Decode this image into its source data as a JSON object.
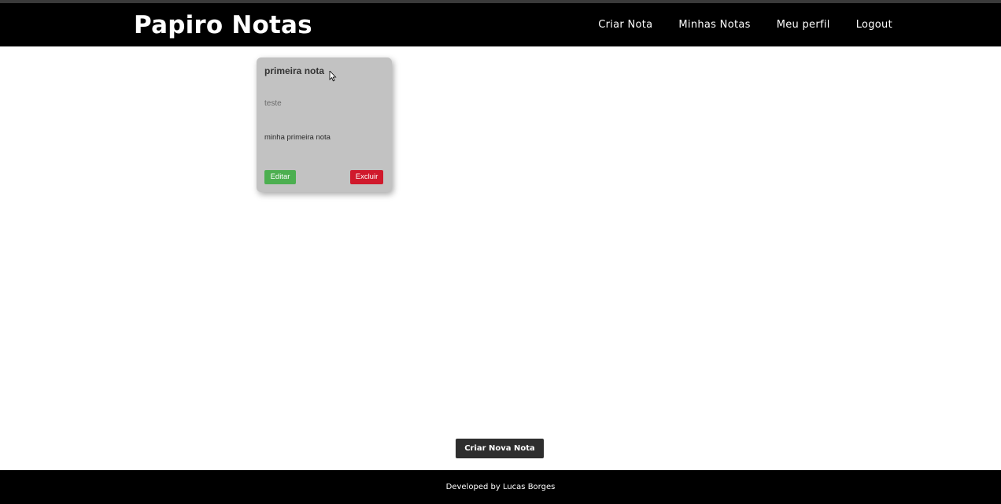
{
  "header": {
    "brand": "Papiro Notas",
    "nav": [
      {
        "label": "Criar Nota"
      },
      {
        "label": "Minhas Notas"
      },
      {
        "label": "Meu perfil"
      },
      {
        "label": "Logout"
      }
    ]
  },
  "notes": [
    {
      "title": "primeira nota",
      "subtitle": "teste",
      "body": "minha primeira nota",
      "edit_label": "Editar",
      "delete_label": "Excluir"
    }
  ],
  "main": {
    "new_note_label": "Criar Nova Nota"
  },
  "footer": {
    "text": "Developed by Lucas Borges"
  },
  "colors": {
    "navbar_bg": "#000000",
    "card_bg": "#c2c2c2",
    "edit_button": "#4caf50",
    "delete_button": "#d0192c",
    "new_note_button": "#2e2e2e"
  },
  "icons": {
    "cursor": "mouse-pointer-icon"
  }
}
